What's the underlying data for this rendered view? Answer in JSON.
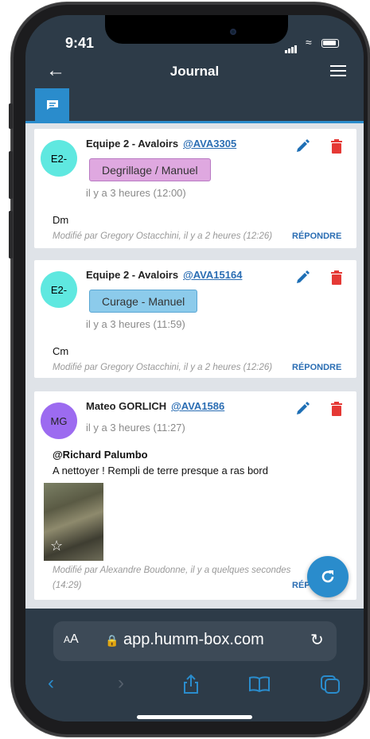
{
  "status": {
    "time": "9:41"
  },
  "header": {
    "title": "Journal"
  },
  "posts": [
    {
      "initials": "E2-",
      "avatar_color": "#5fe8e0",
      "author": "Equipe 2 - Avaloirs",
      "ref": "@AVA3305",
      "tag": "Degrillage / Manuel",
      "tag_bg": "#dfa8e0",
      "tag_border": "#b879c3",
      "ago": "il y a 3 heures (12:00)",
      "message": "Dm",
      "modified": "Modifié par Gregory Ostacchini, il y a 2 heures (12:26)",
      "reply": "RÉPONDRE"
    },
    {
      "initials": "E2-",
      "avatar_color": "#5fe8e0",
      "author": "Equipe 2 - Avaloirs",
      "ref": "@AVA15164",
      "tag": "Curage - Manuel",
      "tag_bg": "#8ccbeb",
      "tag_border": "#5aa6d3",
      "ago": "il y a 3 heures (11:59)",
      "message": "Cm",
      "modified": "Modifié par Gregory Ostacchini, il y a 2 heures (12:26)",
      "reply": "RÉPONDRE"
    },
    {
      "initials": "MG",
      "avatar_color": "#9c6bf0",
      "author": "Mateo GORLICH",
      "ref": "@AVA1586",
      "ago": "il y a 3 heures (11:27)",
      "mention": "@Richard Palumbo",
      "message": "A nettoyer ! Rempli de terre presque a ras bord",
      "modified": "Modifié par Alexandre Boudonne, il y a quelques secondes",
      "modified_time": "(14:29)",
      "reply": "RÉP"
    }
  ],
  "browser": {
    "text_size": "AA",
    "url": "app.humm-box.com"
  },
  "colors": {
    "accent": "#2a8ccc",
    "header_bg": "#2d3b48",
    "delete": "#e53935"
  },
  "icons": [
    "back-arrow-icon",
    "hamburger-menu-icon",
    "chat-icon",
    "pencil-icon",
    "trash-icon",
    "star-icon",
    "refresh-icon",
    "lock-icon",
    "reload-icon",
    "chevron-left-icon",
    "chevron-right-icon",
    "share-icon",
    "bookmarks-icon",
    "tabs-icon"
  ]
}
